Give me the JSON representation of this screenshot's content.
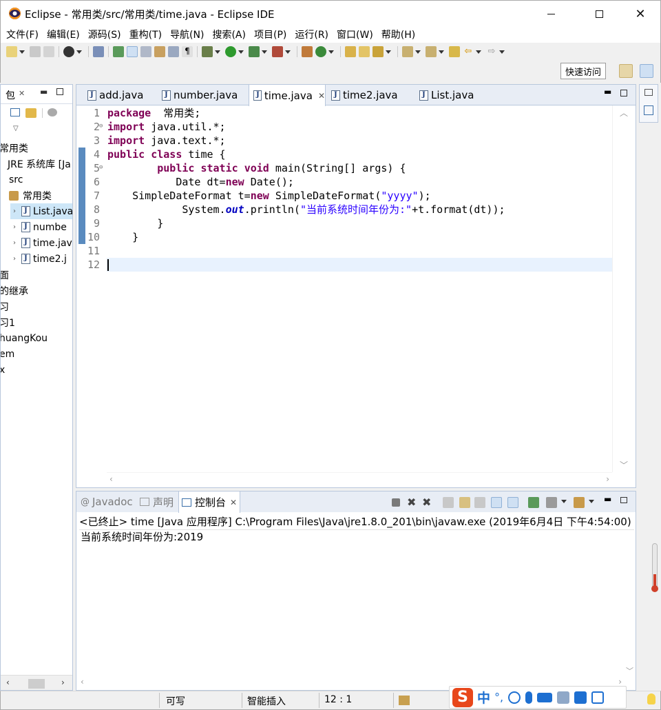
{
  "window": {
    "title": "Eclipse - 常用类/src/常用类/time.java - Eclipse IDE",
    "close_glyph": "✕"
  },
  "menu": [
    "文件(F)",
    "编辑(E)",
    "源码(S)",
    "重构(T)",
    "导航(N)",
    "搜索(A)",
    "项目(P)",
    "运行(R)",
    "窗口(W)",
    "帮助(H)"
  ],
  "quick_access": "快速访问",
  "package_explorer": {
    "tab_label": "包",
    "tree": [
      {
        "text": "常用类",
        "indent": 0,
        "kind": "project"
      },
      {
        "text": "JRE 系统库 [Ja",
        "indent": 1,
        "kind": "lib"
      },
      {
        "text": "src",
        "indent": 1,
        "kind": "folder"
      },
      {
        "text": "常用类",
        "indent": 2,
        "kind": "package"
      },
      {
        "text": "List.java",
        "indent": 3,
        "kind": "file",
        "selected": true
      },
      {
        "text": "numbe",
        "indent": 3,
        "kind": "file"
      },
      {
        "text": "time.jav",
        "indent": 3,
        "kind": "file"
      },
      {
        "text": "time2.j",
        "indent": 3,
        "kind": "file"
      },
      {
        "text": "面",
        "indent": 0,
        "kind": "project"
      },
      {
        "text": "的继承",
        "indent": 0,
        "kind": "project"
      },
      {
        "text": "习",
        "indent": 0,
        "kind": "project"
      },
      {
        "text": "习1",
        "indent": 0,
        "kind": "project"
      },
      {
        "text": "huangKou",
        "indent": 0,
        "kind": "project"
      },
      {
        "text": "em",
        "indent": 0,
        "kind": "project"
      },
      {
        "text": "x",
        "indent": 0,
        "kind": "project"
      }
    ]
  },
  "editor": {
    "tabs": [
      {
        "label": "add.java",
        "active": false
      },
      {
        "label": "number.java",
        "active": false
      },
      {
        "label": "time.java",
        "active": true
      },
      {
        "label": "time2.java",
        "active": false
      },
      {
        "label": "List.java",
        "active": false
      }
    ],
    "lines": [
      {
        "n": "1",
        "segs": [
          [
            "kw",
            "package"
          ],
          [
            "",
            "  常用类;"
          ]
        ]
      },
      {
        "n": "2",
        "fold": true,
        "segs": [
          [
            "kw",
            "import"
          ],
          [
            "",
            " java.util.*;"
          ]
        ]
      },
      {
        "n": "3",
        "segs": [
          [
            "kw",
            "import"
          ],
          [
            "",
            " java.text.*;"
          ]
        ]
      },
      {
        "n": "4",
        "segs": [
          [
            "kw",
            "public"
          ],
          [
            "",
            " "
          ],
          [
            "kw",
            "class"
          ],
          [
            "",
            " time {"
          ]
        ]
      },
      {
        "n": "5",
        "fold": true,
        "segs": [
          [
            "",
            "        "
          ],
          [
            "kw",
            "public"
          ],
          [
            "",
            " "
          ],
          [
            "kw",
            "static"
          ],
          [
            "",
            " "
          ],
          [
            "kw",
            "void"
          ],
          [
            "",
            " main(String[] args) {"
          ]
        ]
      },
      {
        "n": "6",
        "segs": [
          [
            "",
            "           Date dt="
          ],
          [
            "kw",
            "new"
          ],
          [
            "",
            " Date();"
          ]
        ]
      },
      {
        "n": "7",
        "segs": [
          [
            "",
            "    SimpleDateFormat t="
          ],
          [
            "kw",
            "new"
          ],
          [
            "",
            " SimpleDateFormat("
          ],
          [
            "str",
            "\"yyyy\""
          ],
          [
            "",
            ");"
          ]
        ]
      },
      {
        "n": "8",
        "segs": [
          [
            "",
            "            System."
          ],
          [
            "fld",
            "out"
          ],
          [
            "",
            ".println("
          ],
          [
            "str",
            "\"当前系统时间年份为:\""
          ],
          [
            "",
            "+t.format(dt));"
          ]
        ]
      },
      {
        "n": "9",
        "segs": [
          [
            "",
            "        }"
          ]
        ]
      },
      {
        "n": "10",
        "segs": [
          [
            "",
            "    }"
          ]
        ]
      },
      {
        "n": "11",
        "segs": []
      },
      {
        "n": "12",
        "segs": [],
        "current": true
      }
    ]
  },
  "console": {
    "tabs": [
      {
        "label": "Javadoc",
        "active": false,
        "glyph": "@"
      },
      {
        "label": "声明",
        "active": false
      },
      {
        "label": "控制台",
        "active": true
      }
    ],
    "status_line": "<已终止> time [Java 应用程序] C:\\Program Files\\Java\\jre1.8.0_201\\bin\\javaw.exe  (2019年6月4日 下午4:54:00)",
    "output": "当前系统时间年份为:2019"
  },
  "statusbar": {
    "writable": "可写",
    "insert_mode": "智能插入",
    "position": "12 : 1"
  },
  "ime": {
    "logo": "S",
    "lang": "中",
    "punct": "°,"
  }
}
